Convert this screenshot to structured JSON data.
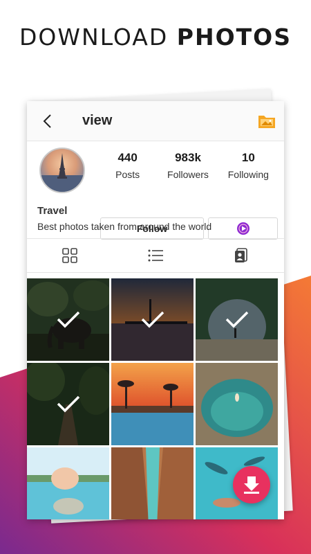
{
  "headline": {
    "light": "DOWNLOAD",
    "bold": "PHOTOS"
  },
  "header": {
    "title": "view"
  },
  "profile": {
    "stats": [
      {
        "value": "440",
        "label": "Posts"
      },
      {
        "value": "983k",
        "label": "Followers"
      },
      {
        "value": "10",
        "label": "Following"
      }
    ],
    "follow_label": "Follow",
    "name": "Travel",
    "bio": "Best photos taken from around the world"
  },
  "tabs": [
    "grid-icon",
    "list-icon",
    "tagged-icon"
  ],
  "photos": [
    {
      "subject": "elephant in forest",
      "selected": true
    },
    {
      "subject": "pier at sunset",
      "selected": true
    },
    {
      "subject": "sea cave beach",
      "selected": true
    },
    {
      "subject": "jungle rope bridge",
      "selected": true
    },
    {
      "subject": "resort pool sunset",
      "selected": false
    },
    {
      "subject": "rock pool",
      "selected": false
    },
    {
      "subject": "pig swimming",
      "selected": false
    },
    {
      "subject": "canyon river",
      "selected": false
    },
    {
      "subject": "swimming with sharks",
      "selected": false
    }
  ],
  "colors": {
    "accent": "#e8315f",
    "folder": "#f5a623",
    "play": "#8e2bd1"
  }
}
